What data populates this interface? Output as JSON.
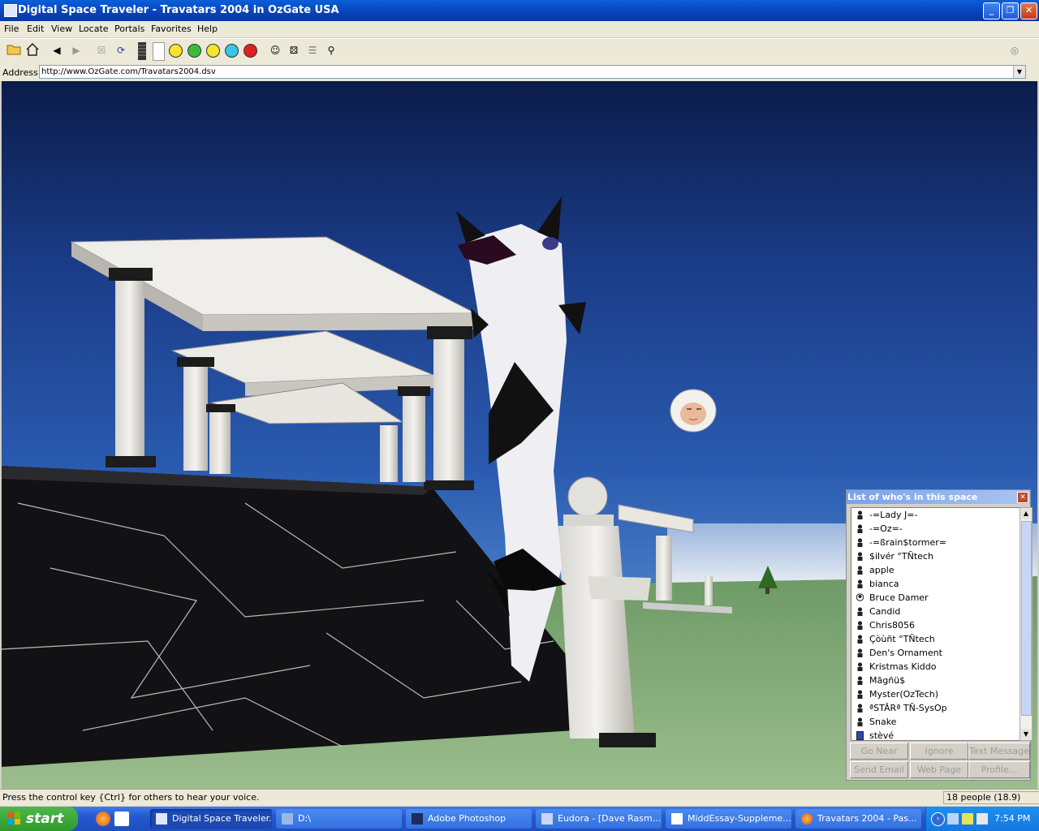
{
  "window": {
    "title": "Digital Space Traveler - Travatars 2004 in OzGate USA",
    "controls": [
      "minimize-icon",
      "restore-icon",
      "close-icon"
    ]
  },
  "menu": [
    "File",
    "Edit",
    "View",
    "Locate",
    "Portals",
    "Favorites",
    "Help"
  ],
  "toolbar": {
    "icons": [
      "open-folder-icon",
      "home-icon",
      "back-arrow-icon",
      "forward-arrow-icon",
      "stop-icon",
      "refresh-icon",
      "volume-bar-icon",
      "happy-face-icon",
      "surprised-face-icon",
      "neutral-face-icon",
      "sad-face-icon",
      "angry-face-icon",
      "avatar-tool-icon",
      "dice-icon",
      "notes-icon",
      "search-people-icon",
      "logo-icon"
    ],
    "emotion_colors": [
      "#f5e42a",
      "#3bbb3b",
      "#f5e42a",
      "#38c6e8",
      "#e02020"
    ]
  },
  "address": {
    "label": "Address:",
    "value": "http://www.OzGate.com/Travatars2004.dsv"
  },
  "who_panel": {
    "title": "List of who's in this space",
    "people": [
      "-=Lady J=-",
      "-=Oz=-",
      "-=ßrain$tormer=",
      "$ilvér °TÑtech",
      "apple",
      "bianca",
      "Bruce Damer",
      "Candid",
      "Chris8056",
      "Çòùñt °TÑtech",
      "Den's Ornament",
      "Kristmas Kiddo",
      "Mãgñü$",
      "Myster(OzTech)",
      "ªSTÂRª TÑ-SysOp",
      "Snake",
      "stèvé"
    ],
    "buttons": [
      "Go Near",
      "Ignore",
      "Text Message",
      "Send Email",
      "Web Page",
      "Profile..."
    ]
  },
  "status": {
    "message": "Press the control key {Ctrl} for others to hear your voice.",
    "people_count": "18 people (18.9)"
  },
  "taskbar": {
    "start": "start",
    "tasks": [
      "Digital Space Traveler...",
      "D:\\",
      "Adobe Photoshop",
      "Eudora - [Dave Rasm...",
      "MiddEssay-Suppleme...",
      "Travatars 2004 - Pas..."
    ],
    "clock": "7:54 PM"
  }
}
